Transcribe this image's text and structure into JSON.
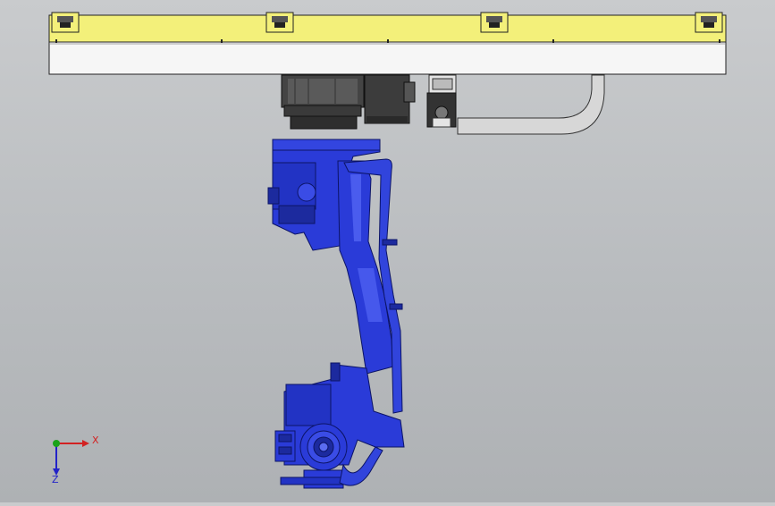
{
  "viewport": {
    "background": "#bfc2c4",
    "rail": {
      "yellow": "#f3f07a",
      "white": "#f6f6f6",
      "marker_count": 5,
      "carriage_count": 4
    },
    "robot": {
      "color": "#2a3bd8",
      "shadow": "#1c2a9e",
      "highlight": "#5b6cf0"
    },
    "motor_block": {
      "color": "#3c3c3c"
    },
    "cable_duct": {
      "color": "#d7d7d7"
    }
  },
  "triad": {
    "x_label": "X",
    "z_label": "Z",
    "x_color": "#d22222",
    "z_color": "#2222c8",
    "y_color": "#1aa31a"
  }
}
